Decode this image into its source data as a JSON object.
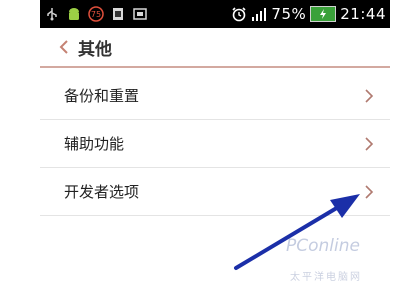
{
  "status_bar": {
    "battery_level": "75%",
    "time": "21:44",
    "icons": [
      "usb-icon",
      "android-icon",
      "notification-icon",
      "sd-card-icon",
      "screenshot-icon",
      "alarm-icon",
      "signal-icon",
      "battery-icon"
    ]
  },
  "header": {
    "title": "其他"
  },
  "settings": {
    "items": [
      {
        "label": "备份和重置"
      },
      {
        "label": "辅助功能"
      },
      {
        "label": "开发者选项"
      }
    ]
  },
  "watermark": {
    "brand": "PConline",
    "sub": "太平洋电脑网"
  },
  "colors": {
    "accent_divider": "#d3a9a0",
    "annotation_arrow": "#1b2fa8"
  }
}
